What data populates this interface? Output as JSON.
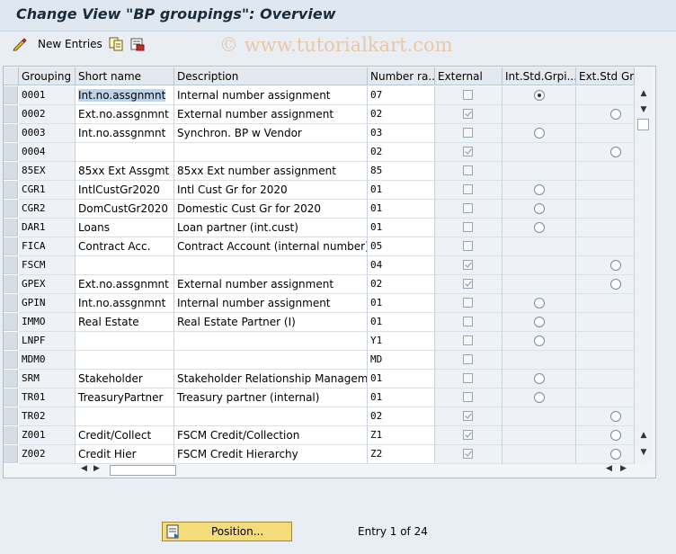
{
  "window": {
    "title": "Change View \"BP groupings\": Overview"
  },
  "toolbar": {
    "new_entries_label": "New Entries",
    "icons": [
      "glasses-pencil-icon",
      "copy-icon",
      "delete-icon"
    ]
  },
  "watermark": "© www.tutorialkart.com",
  "table": {
    "columns": [
      "Grouping",
      "Short name",
      "Description",
      "Number ra...",
      "External",
      "Int.Std.Grpi...",
      "Ext.Std Grp"
    ],
    "rows": [
      {
        "grouping": "0001",
        "short": "Int.no.assgnmnt",
        "desc": "Internal number assignment",
        "range": "07",
        "external": false,
        "int_std": "selected",
        "ext_std": "none"
      },
      {
        "grouping": "0002",
        "short": "Ext.no.assgnmnt",
        "desc": "External number assignment",
        "range": "02",
        "external": true,
        "int_std": "none",
        "ext_std": "empty"
      },
      {
        "grouping": "0003",
        "short": "Int.no.assgnmnt",
        "desc": "Synchron. BP w Vendor",
        "range": "03",
        "external": false,
        "int_std": "empty",
        "ext_std": "none"
      },
      {
        "grouping": "0004",
        "short": "",
        "desc": "",
        "range": "02",
        "external": true,
        "int_std": "none",
        "ext_std": "empty"
      },
      {
        "grouping": "85EX",
        "short": "85xx Ext Assgmt",
        "desc": "85xx Ext number assignment",
        "range": "85",
        "external": false,
        "int_std": "none",
        "ext_std": "none"
      },
      {
        "grouping": "CGR1",
        "short": "IntlCustGr2020",
        "desc": "Intl Cust Gr for 2020",
        "range": "01",
        "external": false,
        "int_std": "empty",
        "ext_std": "none"
      },
      {
        "grouping": "CGR2",
        "short": "DomCustGr2020",
        "desc": "Domestic Cust Gr for 2020",
        "range": "01",
        "external": false,
        "int_std": "empty",
        "ext_std": "none"
      },
      {
        "grouping": "DAR1",
        "short": "Loans",
        "desc": "Loan partner (int.cust)",
        "range": "01",
        "external": false,
        "int_std": "empty",
        "ext_std": "none"
      },
      {
        "grouping": "FICA",
        "short": "Contract Acc.",
        "desc": "Contract Account (internal number)",
        "range": "05",
        "external": false,
        "int_std": "none",
        "ext_std": "none"
      },
      {
        "grouping": "FSCM",
        "short": "",
        "desc": "",
        "range": "04",
        "external": true,
        "int_std": "none",
        "ext_std": "empty"
      },
      {
        "grouping": "GPEX",
        "short": "Ext.no.assgnmnt",
        "desc": "External number assignment",
        "range": "02",
        "external": true,
        "int_std": "none",
        "ext_std": "empty"
      },
      {
        "grouping": "GPIN",
        "short": "Int.no.assgnmnt",
        "desc": "Internal number assignment",
        "range": "01",
        "external": false,
        "int_std": "empty",
        "ext_std": "none"
      },
      {
        "grouping": "IMMO",
        "short": "Real Estate",
        "desc": "Real Estate Partner (I)",
        "range": "01",
        "external": false,
        "int_std": "empty",
        "ext_std": "none"
      },
      {
        "grouping": "LNPF",
        "short": "",
        "desc": "",
        "range": "Y1",
        "external": false,
        "int_std": "empty",
        "ext_std": "none"
      },
      {
        "grouping": "MDM0",
        "short": "",
        "desc": "",
        "range": "MD",
        "external": false,
        "int_std": "none",
        "ext_std": "none"
      },
      {
        "grouping": "SRM",
        "short": "Stakeholder",
        "desc": "Stakeholder Relationship Management",
        "range": "01",
        "external": false,
        "int_std": "empty",
        "ext_std": "none"
      },
      {
        "grouping": "TR01",
        "short": "TreasuryPartner",
        "desc": "Treasury partner (internal)",
        "range": "01",
        "external": false,
        "int_std": "empty",
        "ext_std": "none"
      },
      {
        "grouping": "TR02",
        "short": "",
        "desc": "",
        "range": "02",
        "external": true,
        "int_std": "none",
        "ext_std": "empty"
      },
      {
        "grouping": "Z001",
        "short": "Credit/Collect",
        "desc": "FSCM Credit/Collection",
        "range": "Z1",
        "external": true,
        "int_std": "none",
        "ext_std": "empty"
      },
      {
        "grouping": "Z002",
        "short": "Credit Hier",
        "desc": "FSCM Credit Hierarchy",
        "range": "Z2",
        "external": true,
        "int_std": "none",
        "ext_std": "empty"
      }
    ]
  },
  "footer": {
    "position_label": "Position...",
    "entry_info": "Entry 1 of 24"
  }
}
